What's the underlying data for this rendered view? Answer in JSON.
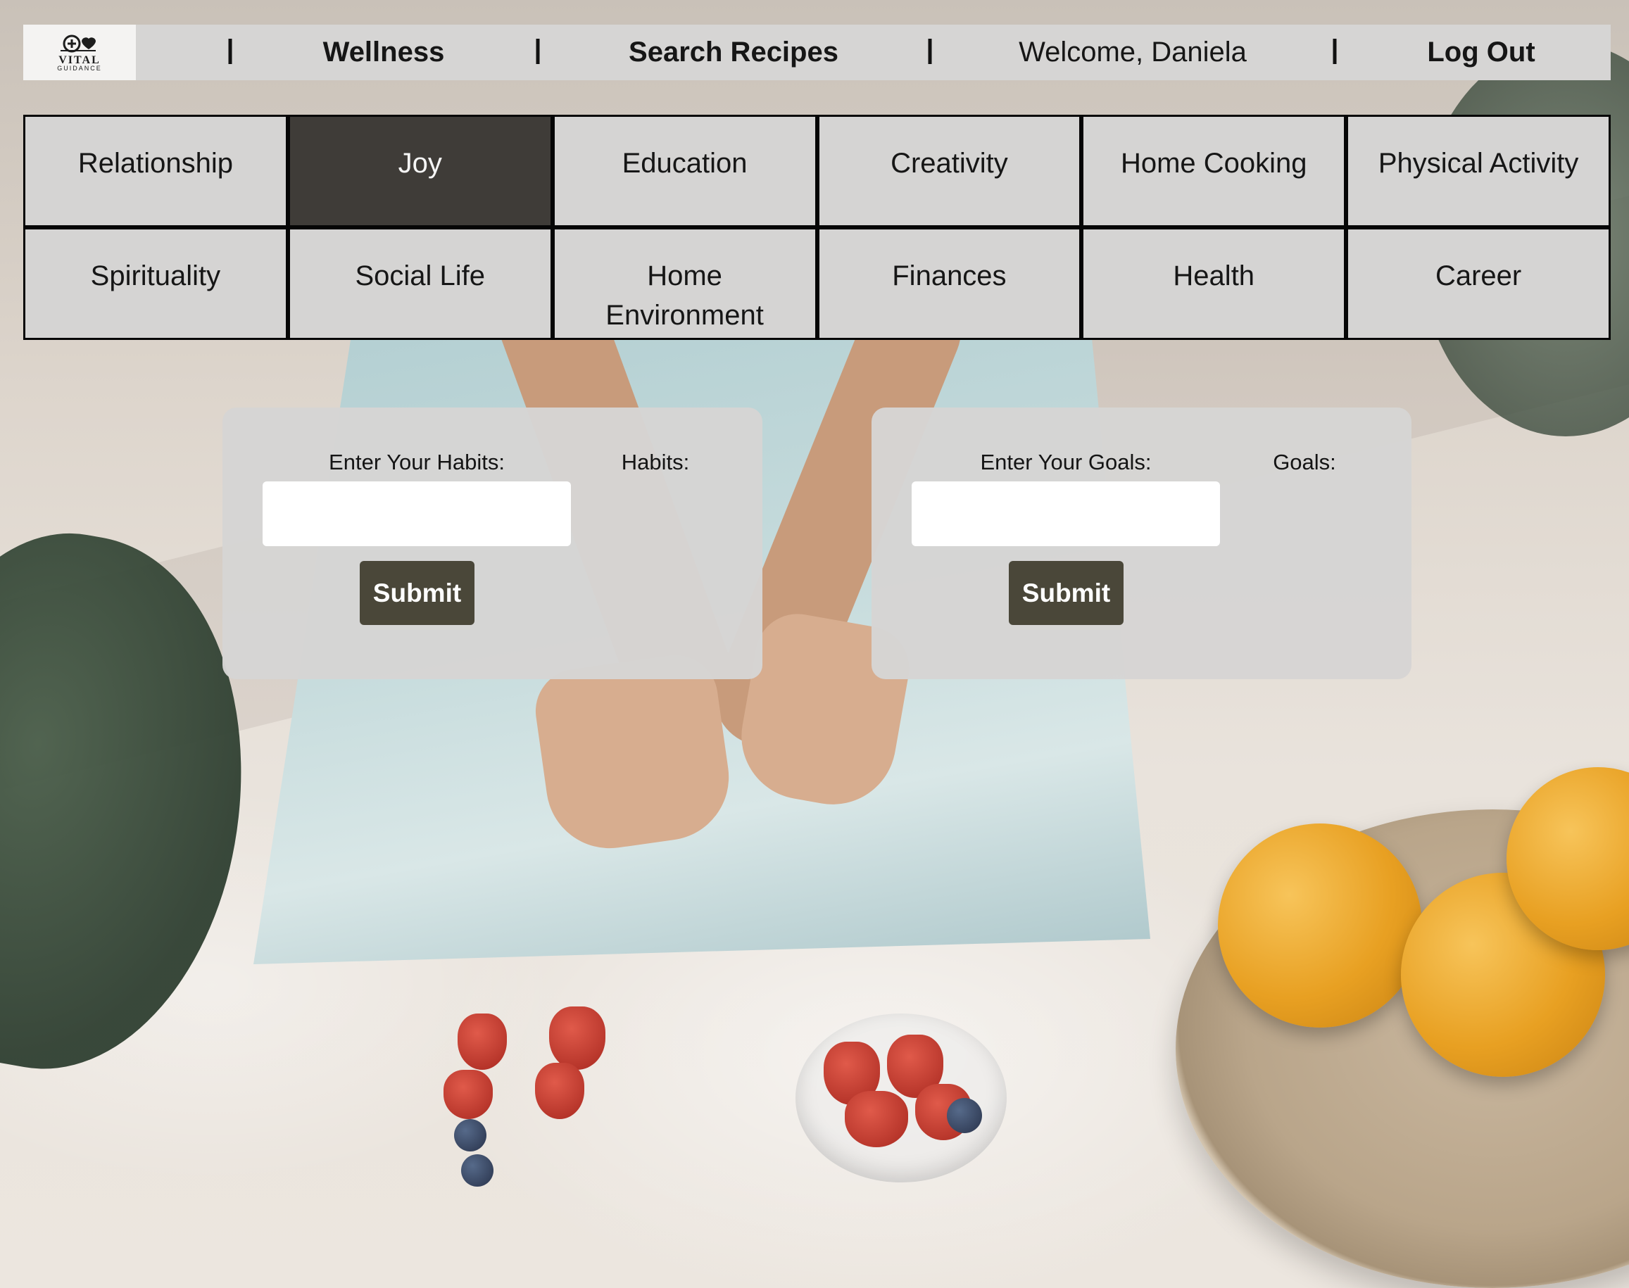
{
  "header": {
    "logo": {
      "text": "VITAL",
      "subtext": "GUIDANCE",
      "icon": "heart-health-icon"
    },
    "nav": [
      {
        "label": "Wellness",
        "bold": true
      },
      {
        "label": "Search Recipes",
        "bold": true
      },
      {
        "label": "Welcome, Daniela",
        "bold": false
      },
      {
        "label": "Log Out",
        "bold": true
      }
    ],
    "separator": "|"
  },
  "categories": {
    "active": "Joy",
    "items": [
      "Relationship",
      "Joy",
      "Education",
      "Creativity",
      "Home Cooking",
      "Physical Activity",
      "Spirituality",
      "Social Life",
      "Home Environment",
      "Finances",
      "Health",
      "Career"
    ]
  },
  "habits_card": {
    "input_label": "Enter Your Habits:",
    "list_label": "Habits:",
    "input_value": "",
    "submit_label": "Submit"
  },
  "goals_card": {
    "input_label": "Enter Your Goals:",
    "list_label": "Goals:",
    "input_value": "",
    "submit_label": "Submit"
  },
  "colors": {
    "bar_bg": "#d6d5d4",
    "tile_bg": "#d5d4d3",
    "tile_active_bg": "#3f3c38",
    "grid_border": "#060606",
    "button_bg": "#4a4739"
  }
}
